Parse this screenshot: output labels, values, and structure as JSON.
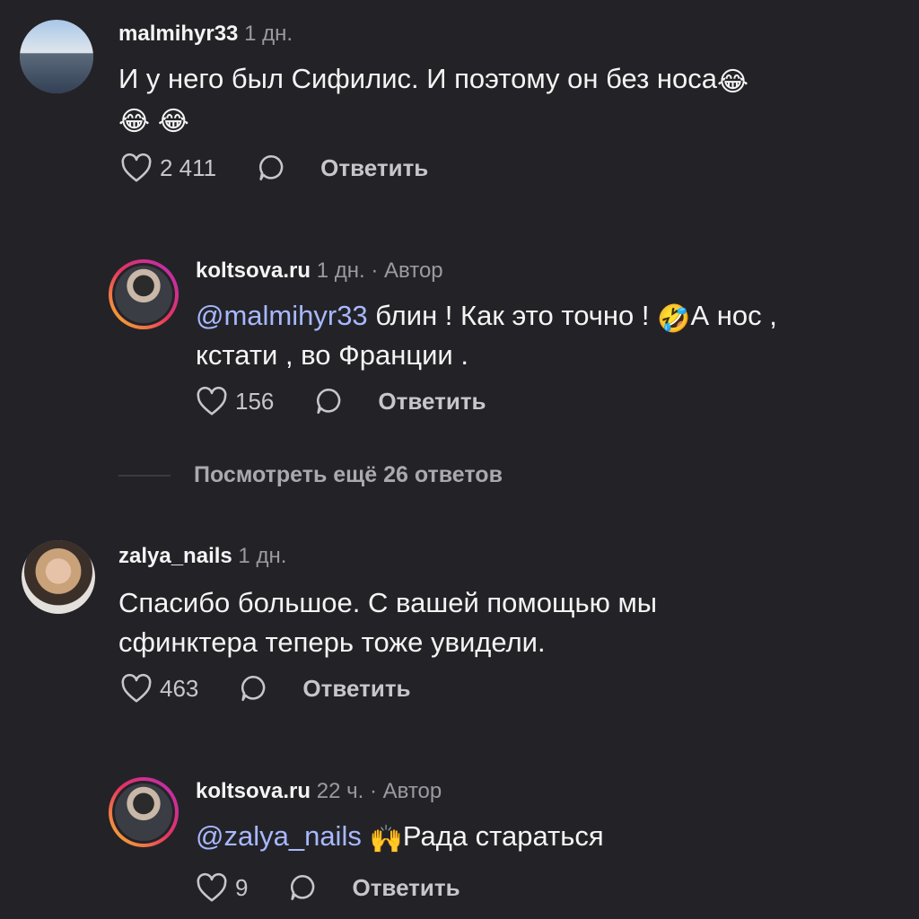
{
  "comments": [
    {
      "username": "malmihyr33",
      "time": "1 дн.",
      "text_line1": "И у него был Сифилис. И поэтому он без носа",
      "emoji": "😂",
      "likes": "2 411",
      "reply_label": "Ответить"
    },
    {
      "username": "koltsova.ru",
      "time": "1 дн.",
      "author_label": "· Автор",
      "mention": "@malmihyr33",
      "text_part1": " блин ! Как это точно ! ",
      "emoji": "🤣",
      "text_part2": "А нос ,",
      "text_line2": "кстати , во Франции .",
      "likes": "156",
      "reply_label": "Ответить"
    },
    {
      "username": "zalya_nails",
      "time": "1 дн.",
      "text_line1": "Спасибо большое. С вашей помощью мы",
      "text_line2": "сфинктера теперь тоже увидели.",
      "likes": "463",
      "reply_label": "Ответить"
    },
    {
      "username": "koltsova.ru",
      "time": "22 ч.",
      "author_label": "· Автор",
      "mention": "@zalya_nails",
      "emoji": "🙌",
      "text": "Рада стараться",
      "likes": "9",
      "reply_label": "Ответить"
    }
  ],
  "view_more": "Посмотреть ещё 26 ответов",
  "icons": {
    "like": "heart-icon",
    "reply": "speech-bubble-icon"
  },
  "colors": {
    "background": "#232327",
    "mention": "#a7b8ff",
    "muted": "#9a9aa0"
  }
}
